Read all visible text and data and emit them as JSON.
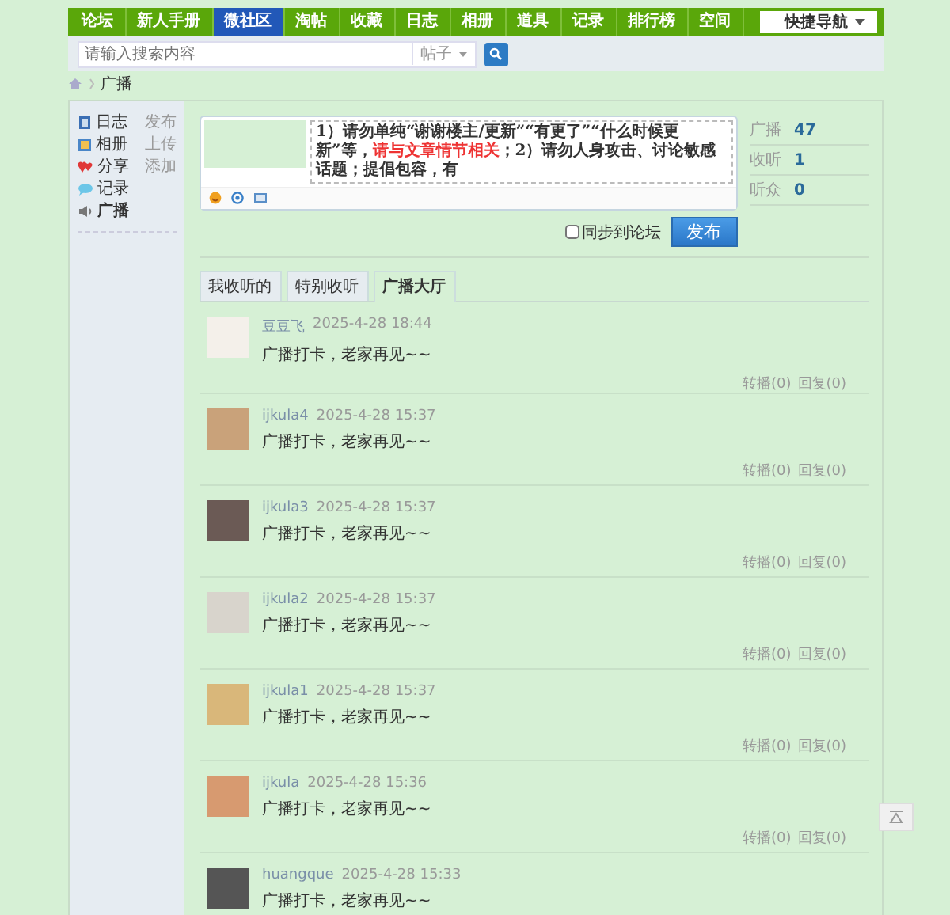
{
  "nav": {
    "items": [
      {
        "label": "论坛",
        "selected": false
      },
      {
        "label": "新人手册",
        "selected": false
      },
      {
        "label": "微社区",
        "selected": true
      },
      {
        "label": "淘帖",
        "selected": false
      },
      {
        "label": "收藏",
        "selected": false
      },
      {
        "label": "日志",
        "selected": false
      },
      {
        "label": "相册",
        "selected": false
      },
      {
        "label": "道具",
        "selected": false
      },
      {
        "label": "记录",
        "selected": false
      },
      {
        "label": "排行榜",
        "selected": false
      },
      {
        "label": "空间",
        "selected": false
      }
    ],
    "quick_nav": "快捷导航"
  },
  "search": {
    "placeholder": "请输入搜索内容",
    "scope": "帖子"
  },
  "breadcrumb": [
    "广播"
  ],
  "sidebar": {
    "items": [
      {
        "kind": "blog",
        "label": "日志",
        "action": "发布",
        "selected": false
      },
      {
        "kind": "album",
        "label": "相册",
        "action": "上传",
        "selected": false
      },
      {
        "kind": "share",
        "label": "分享",
        "action": "添加",
        "selected": false
      },
      {
        "kind": "record",
        "label": "记录",
        "selected": false
      },
      {
        "kind": "broadcast",
        "label": "广播",
        "selected": true
      }
    ]
  },
  "composer": {
    "notice": [
      {
        "text": "1）请勿单纯“谢谢楼主/更新”“有更了”“什么时候更新”等，",
        "warning": false
      },
      {
        "text": "请与文章情节相关",
        "warning": true
      },
      {
        "text": "；2）请勿人身攻击、讨论敏感话题；提倡包容，有",
        "warning": false
      }
    ],
    "sync_label": "同步到论坛",
    "sync_checked": false,
    "publish": "发布"
  },
  "stats": [
    {
      "label": "广播",
      "value": "47"
    },
    {
      "label": "收听",
      "value": "1"
    },
    {
      "label": "听众",
      "value": "0"
    }
  ],
  "tabs": [
    {
      "label": "我收听的",
      "selected": false
    },
    {
      "label": "特别收听",
      "selected": false
    },
    {
      "label": "广播大厅",
      "selected": true
    }
  ],
  "feed": [
    {
      "user": "豆豆飞",
      "time": "2025-4-28 18:44",
      "text": "广播打卡，老家再见~~",
      "forward": "转播(0)",
      "reply": "回复(0)"
    },
    {
      "user": "ijkula4",
      "time": "2025-4-28 15:37",
      "text": "广播打卡，老家再见~~",
      "forward": "转播(0)",
      "reply": "回复(0)"
    },
    {
      "user": "ijkula3",
      "time": "2025-4-28 15:37",
      "text": "广播打卡，老家再见~~",
      "forward": "转播(0)",
      "reply": "回复(0)"
    },
    {
      "user": "ijkula2",
      "time": "2025-4-28 15:37",
      "text": "广播打卡，老家再见~~",
      "forward": "转播(0)",
      "reply": "回复(0)"
    },
    {
      "user": "ijkula1",
      "time": "2025-4-28 15:37",
      "text": "广播打卡，老家再见~~",
      "forward": "转播(0)",
      "reply": "回复(0)"
    },
    {
      "user": "ijkula",
      "time": "2025-4-28 15:36",
      "text": "广播打卡，老家再见~~",
      "forward": "转播(0)",
      "reply": "回复(0)"
    },
    {
      "user": "huangque",
      "time": "2025-4-28 15:33",
      "text": "广播打卡，老家再见~~"
    }
  ]
}
